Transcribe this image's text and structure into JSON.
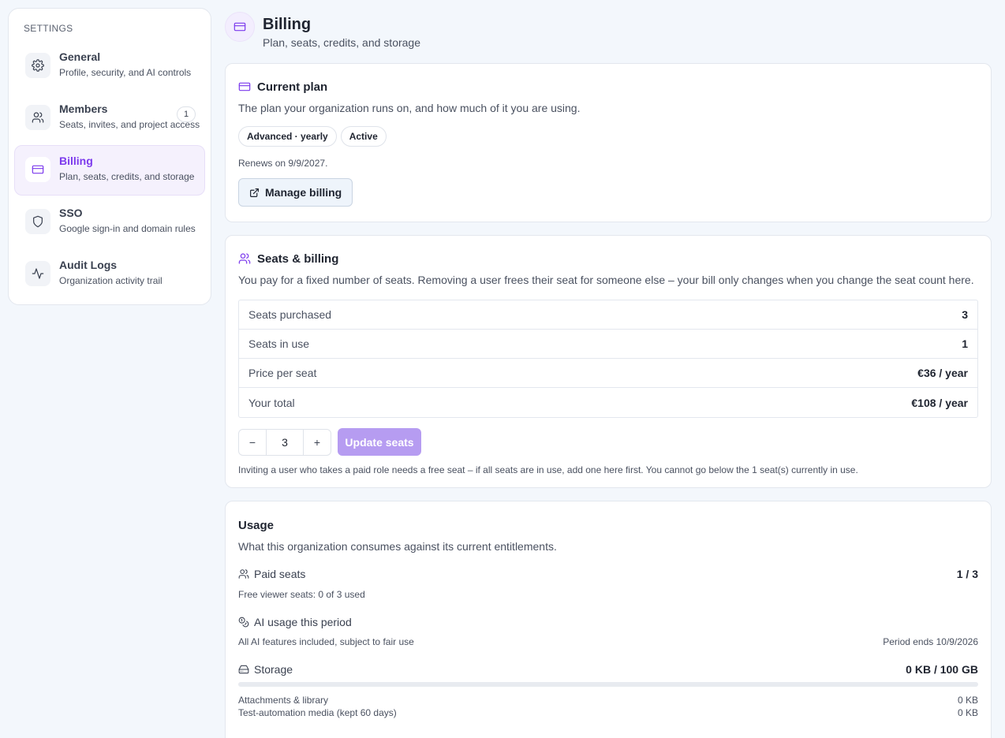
{
  "sidebar": {
    "heading": "SETTINGS",
    "items": [
      {
        "title": "General",
        "subtitle": "Profile, security, and AI controls",
        "icon": "gear-icon"
      },
      {
        "title": "Members",
        "subtitle": "Seats, invites, and project access",
        "icon": "users-icon",
        "badge": "1"
      },
      {
        "title": "Billing",
        "subtitle": "Plan, seats, credits, and storage",
        "icon": "credit-card-icon",
        "active": true
      },
      {
        "title": "SSO",
        "subtitle": "Google sign-in and domain rules",
        "icon": "shield-icon"
      },
      {
        "title": "Audit Logs",
        "subtitle": "Organization activity trail",
        "icon": "activity-icon"
      }
    ]
  },
  "header": {
    "title": "Billing",
    "subtitle": "Plan, seats, credits, and storage",
    "icon": "credit-card-icon"
  },
  "current_plan": {
    "title": "Current plan",
    "description": "The plan your organization runs on, and how much of it you are using.",
    "plan_pill": "Advanced · yearly",
    "status_pill": "Active",
    "renews": "Renews on 9/9/2027.",
    "manage_button": "Manage billing"
  },
  "seats": {
    "title": "Seats & billing",
    "description": "You pay for a fixed number of seats. Removing a user frees their seat for someone else – your bill only changes when you change the seat count here.",
    "rows": [
      {
        "label": "Seats purchased",
        "value": "3"
      },
      {
        "label": "Seats in use",
        "value": "1"
      },
      {
        "label": "Price per seat",
        "value": "€36 / year"
      },
      {
        "label": "Your total",
        "value": "€108 / year"
      }
    ],
    "stepper_minus": "−",
    "stepper_value": "3",
    "stepper_plus": "+",
    "update_button": "Update seats",
    "note": "Inviting a user who takes a paid role needs a free seat – if all seats are in use, add one here first. You cannot go below the 1 seat(s) currently in use."
  },
  "usage": {
    "title": "Usage",
    "description": "What this organization consumes against its current entitlements.",
    "paid_seats_label": "Paid seats",
    "paid_seats_value": "1 / 3",
    "free_viewer": "Free viewer seats: 0 of 3 used",
    "ai_label": "AI usage this period",
    "ai_note": "All AI features included, subject to fair use",
    "ai_period": "Period ends 10/9/2026",
    "storage_label": "Storage",
    "storage_value": "0 KB / 100 GB",
    "storage_fraction": 0,
    "storage_rows": [
      {
        "label": "Attachments & library",
        "value": "0 KB"
      },
      {
        "label": "Test-automation media (kept 60 days)",
        "value": "0 KB"
      }
    ]
  },
  "colors": {
    "accent": "#7c3aed",
    "background": "#f3f7fc"
  }
}
